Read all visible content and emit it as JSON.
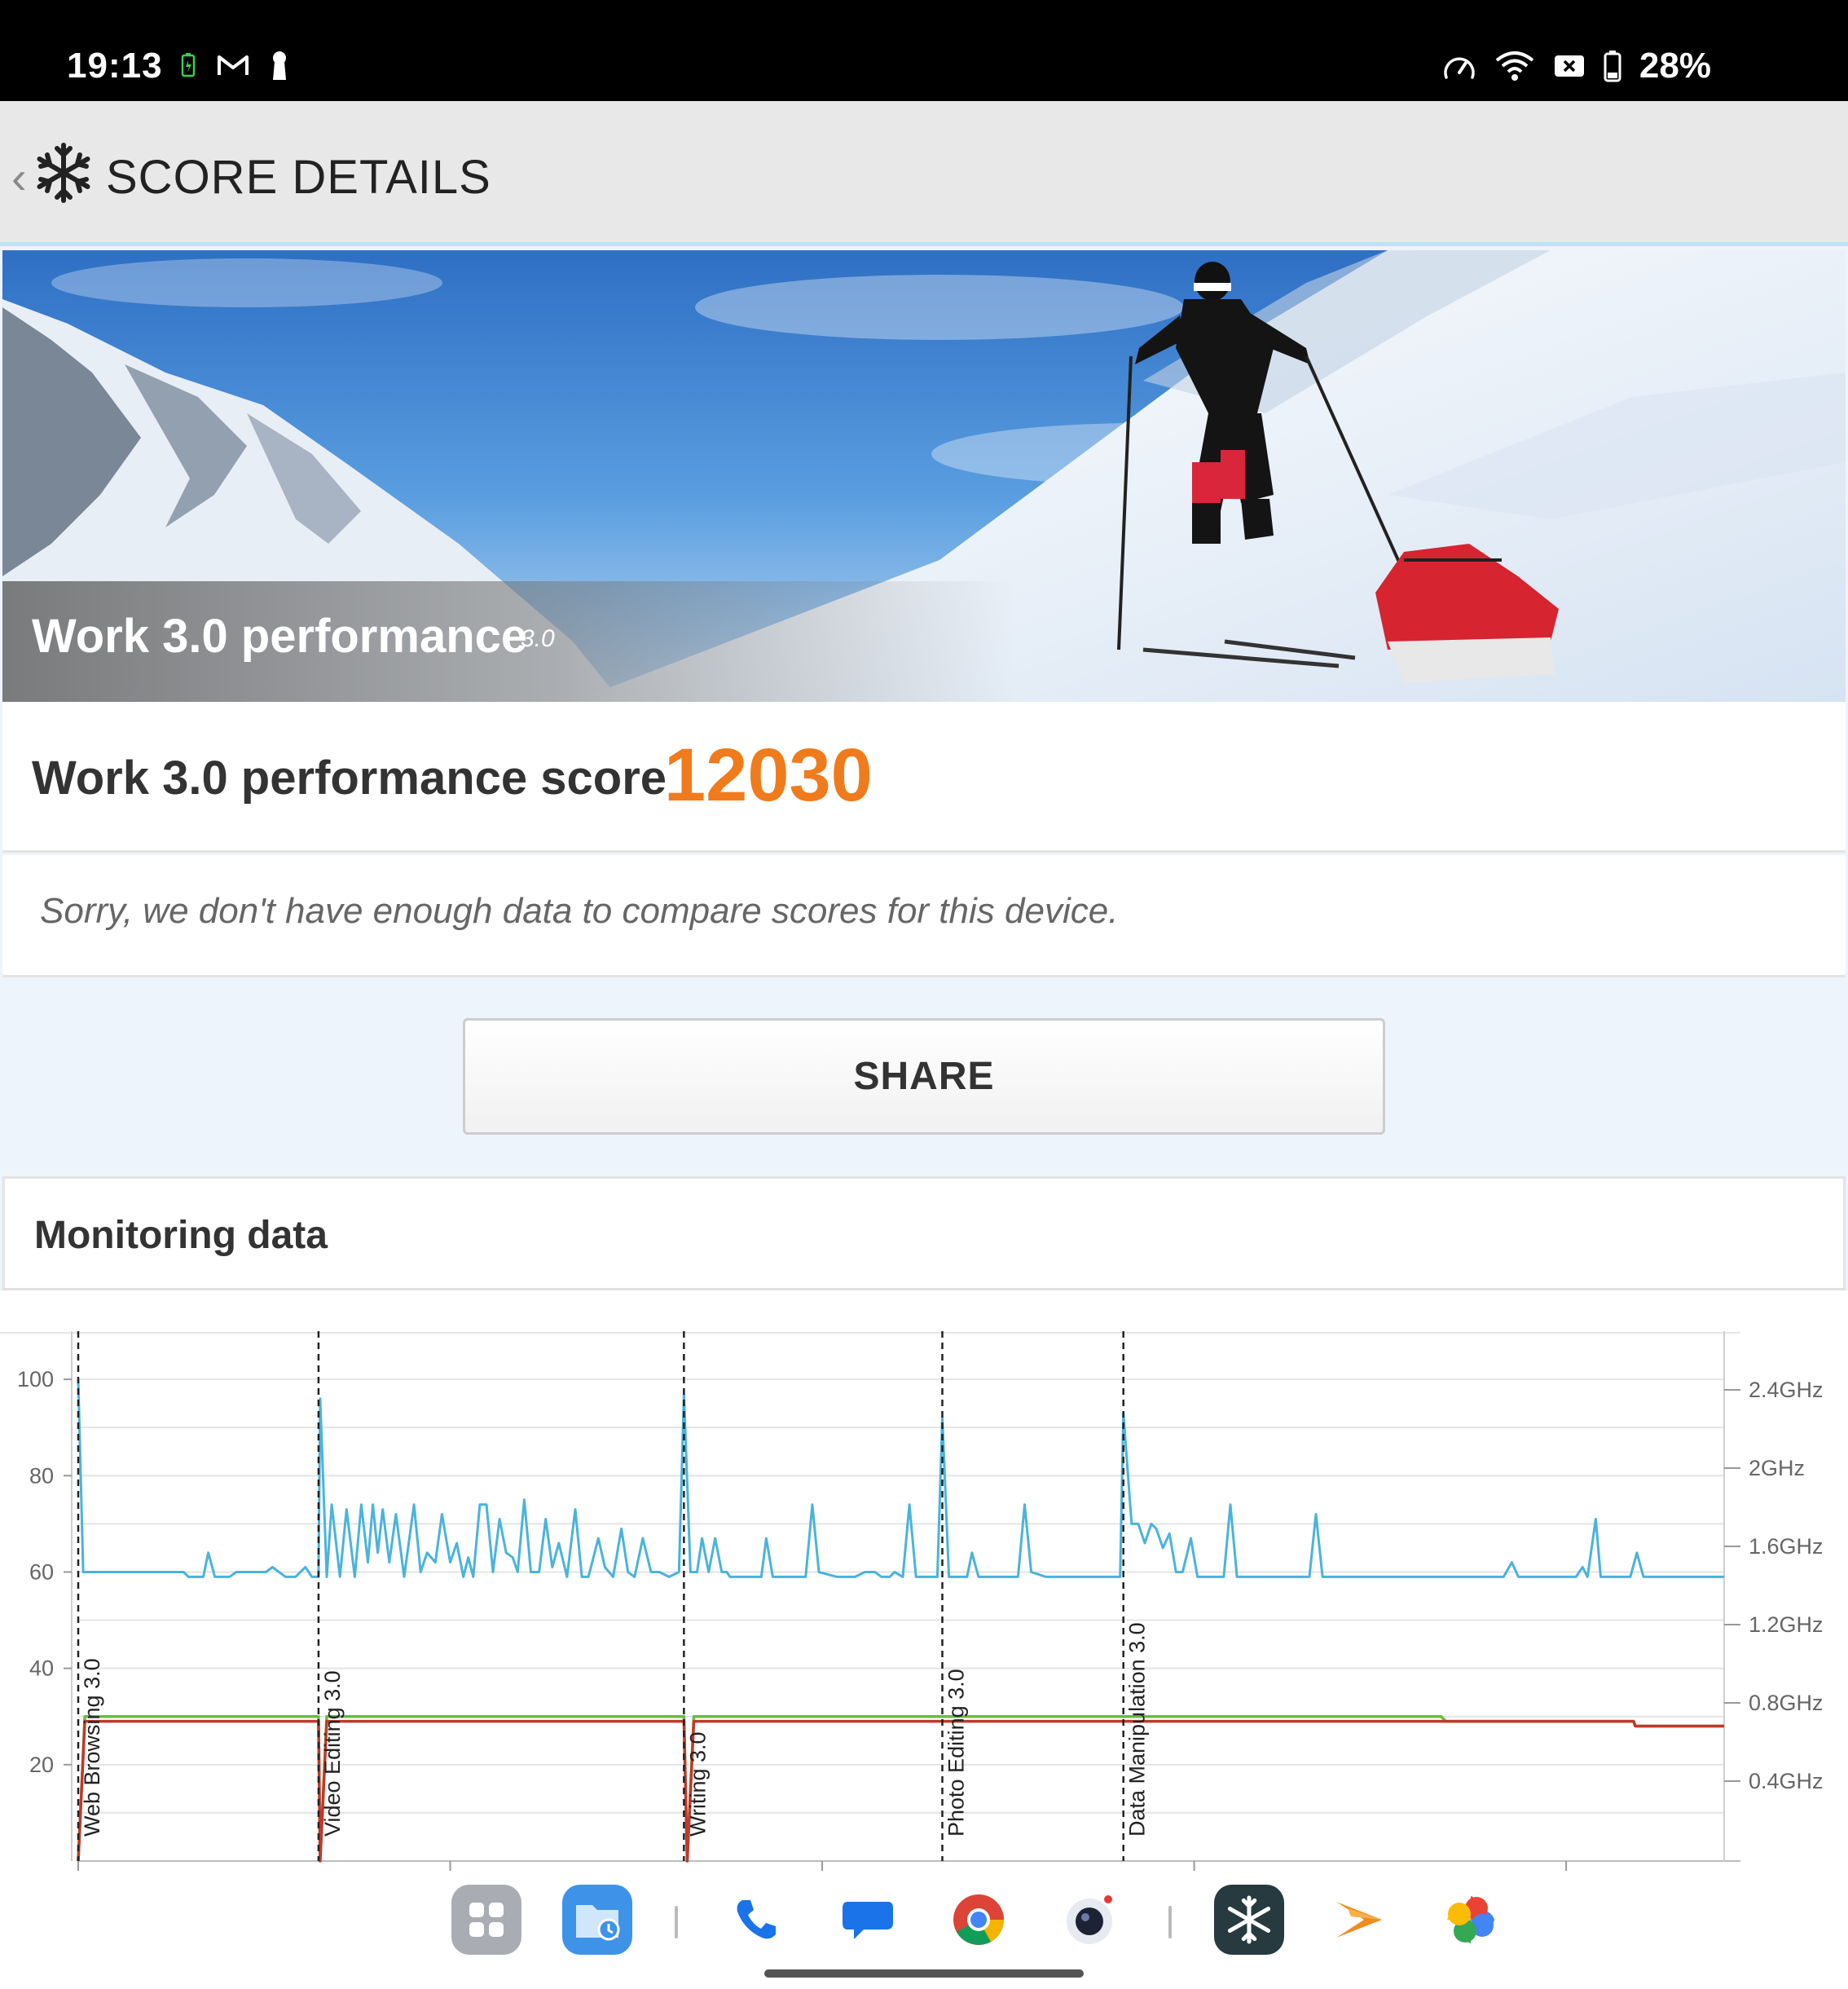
{
  "status_bar": {
    "time": "19:13",
    "battery": "28%",
    "left_icons": [
      "battery-saver-icon",
      "gmail-icon",
      "keyhole-icon"
    ],
    "right_icons": [
      "speedometer-icon",
      "wifi-icon",
      "no-sim-icon",
      "battery-icon"
    ]
  },
  "header": {
    "title": "SCORE DETAILS",
    "logo": "3dmark-snowflake-icon",
    "back": "back-chevron-icon"
  },
  "hero": {
    "title": "Work 3.0 performance",
    "version": "3.0"
  },
  "score": {
    "label": "Work 3.0 performance score",
    "value": "12030",
    "value_color": "#f07b1c"
  },
  "compare": {
    "message": "Sorry, we don't have enough data to compare scores for this device."
  },
  "share": {
    "label": "SHARE"
  },
  "monitoring": {
    "title": "Monitoring data"
  },
  "chart_data": {
    "type": "line",
    "left_axis": {
      "ticks": [
        "100",
        "80",
        "60",
        "40",
        "20"
      ],
      "range": [
        0,
        110
      ]
    },
    "right_axis": {
      "ticks": [
        "2.4GHz",
        "2GHz",
        "1.6GHz",
        "1.2GHz",
        "0.8GHz",
        "0.4GHz"
      ]
    },
    "phases": [
      {
        "label": "Web Browsing 3.0",
        "start": 0
      },
      {
        "label": "Video Editing 3.0",
        "start": 14.6
      },
      {
        "label": "Writing 3.0",
        "start": 36.8
      },
      {
        "label": "Photo Editing 3.0",
        "start": 52.5
      },
      {
        "label": "Data Manipulation 3.0",
        "start": 63.5
      }
    ],
    "x_range": [
      0,
      100
    ],
    "colors": {
      "frequency": "#4ab3dc",
      "battery": "#6bbf3a",
      "temperature": "#c0392b"
    },
    "series": [
      {
        "values": [
          [
            0,
            100
          ],
          [
            0.3,
            60
          ],
          [
            3,
            60
          ],
          [
            3.2,
            60
          ],
          [
            3.5,
            60
          ],
          [
            3.9,
            60
          ],
          [
            4.4,
            60
          ],
          [
            5.2,
            60
          ],
          [
            6,
            60
          ],
          [
            6.4,
            60
          ],
          [
            6.7,
            59
          ],
          [
            7.6,
            59
          ],
          [
            7.9,
            64
          ],
          [
            8.3,
            59
          ],
          [
            9.2,
            59
          ],
          [
            9.6,
            60
          ],
          [
            10,
            60
          ],
          [
            10.3,
            60
          ],
          [
            10.7,
            60
          ],
          [
            11,
            60
          ],
          [
            11.4,
            60
          ],
          [
            11.8,
            61
          ],
          [
            12.2,
            60
          ],
          [
            12.6,
            59
          ],
          [
            13.2,
            59
          ],
          [
            13.8,
            61
          ],
          [
            14.2,
            59
          ],
          [
            14.6,
            59
          ],
          [
            14.7,
            96
          ],
          [
            15.1,
            59
          ],
          [
            15.4,
            74
          ],
          [
            15.9,
            59
          ],
          [
            16.3,
            73
          ],
          [
            16.8,
            59
          ],
          [
            17.2,
            74
          ],
          [
            17.6,
            62
          ],
          [
            17.9,
            74
          ],
          [
            18.2,
            64
          ],
          [
            18.5,
            73
          ],
          [
            18.9,
            62
          ],
          [
            19.3,
            72
          ],
          [
            19.8,
            59
          ],
          [
            20.4,
            74
          ],
          [
            20.8,
            60
          ],
          [
            21.2,
            64
          ],
          [
            21.7,
            62
          ],
          [
            22.1,
            72
          ],
          [
            22.6,
            62
          ],
          [
            23,
            66
          ],
          [
            23.4,
            59
          ],
          [
            23.7,
            63
          ],
          [
            24,
            59
          ],
          [
            24.4,
            74
          ],
          [
            24.8,
            74
          ],
          [
            25.2,
            60
          ],
          [
            25.6,
            71
          ],
          [
            26,
            64
          ],
          [
            26.4,
            63
          ],
          [
            26.7,
            60
          ],
          [
            27.1,
            75
          ],
          [
            27.5,
            60
          ],
          [
            28,
            60
          ],
          [
            28.4,
            71
          ],
          [
            28.8,
            61
          ],
          [
            29.2,
            66
          ],
          [
            29.7,
            59
          ],
          [
            30.2,
            73
          ],
          [
            30.6,
            59
          ],
          [
            31,
            59
          ],
          [
            31.6,
            67
          ],
          [
            32,
            61
          ],
          [
            32.5,
            59
          ],
          [
            33,
            69
          ],
          [
            33.4,
            60
          ],
          [
            33.8,
            59
          ],
          [
            34.3,
            67
          ],
          [
            34.8,
            60
          ],
          [
            35.3,
            60
          ],
          [
            35.9,
            59
          ],
          [
            36.5,
            60
          ],
          [
            36.8,
            97
          ],
          [
            37.2,
            60
          ],
          [
            37.6,
            60
          ],
          [
            37.9,
            67
          ],
          [
            38.3,
            60
          ],
          [
            38.7,
            67
          ],
          [
            39.1,
            60
          ],
          [
            39.4,
            60
          ],
          [
            39.6,
            59
          ],
          [
            40.3,
            59
          ],
          [
            41.5,
            59
          ],
          [
            41.8,
            67
          ],
          [
            42.2,
            59
          ],
          [
            43.3,
            59
          ],
          [
            44.2,
            59
          ],
          [
            44.6,
            74
          ],
          [
            45,
            60
          ],
          [
            46.1,
            59
          ],
          [
            47.2,
            59
          ],
          [
            47.8,
            60
          ],
          [
            48.4,
            60
          ],
          [
            48.8,
            59
          ],
          [
            49.3,
            59
          ],
          [
            49.6,
            60
          ],
          [
            50.1,
            59
          ],
          [
            50.5,
            74
          ],
          [
            50.9,
            59
          ],
          [
            51.6,
            59
          ],
          [
            52.2,
            59
          ],
          [
            52.5,
            92
          ],
          [
            52.9,
            59
          ],
          [
            54,
            59
          ],
          [
            54.3,
            64
          ],
          [
            54.7,
            59
          ],
          [
            57.1,
            59
          ],
          [
            57.5,
            74
          ],
          [
            57.9,
            60
          ],
          [
            58.8,
            59
          ],
          [
            60.3,
            59
          ],
          [
            61.4,
            59
          ],
          [
            62.4,
            59
          ],
          [
            63.3,
            59
          ],
          [
            63.5,
            93
          ],
          [
            64,
            70
          ],
          [
            64.4,
            70
          ],
          [
            64.8,
            66
          ],
          [
            65.2,
            70
          ],
          [
            65.5,
            69
          ],
          [
            65.9,
            65
          ],
          [
            66.3,
            68
          ],
          [
            66.7,
            60
          ],
          [
            67.1,
            60
          ],
          [
            67.6,
            67
          ],
          [
            68,
            59
          ],
          [
            69.6,
            59
          ],
          [
            70,
            74
          ],
          [
            70.4,
            59
          ],
          [
            70.8,
            59
          ],
          [
            71.2,
            59
          ],
          [
            72,
            59
          ],
          [
            72.9,
            59
          ],
          [
            74.8,
            59
          ],
          [
            75.2,
            72
          ],
          [
            75.6,
            59
          ],
          [
            78.8,
            59
          ],
          [
            81,
            59
          ],
          [
            85.6,
            59
          ],
          [
            86.6,
            59
          ],
          [
            87.1,
            62
          ],
          [
            87.5,
            59
          ],
          [
            89,
            59
          ],
          [
            90.2,
            59
          ],
          [
            91,
            59
          ],
          [
            91.4,
            61
          ],
          [
            91.7,
            59
          ],
          [
            92.2,
            71
          ],
          [
            92.5,
            59
          ],
          [
            94.3,
            59
          ],
          [
            94.7,
            64
          ],
          [
            95.1,
            59
          ],
          [
            96.8,
            59
          ],
          [
            98.8,
            59
          ],
          [
            100,
            59
          ]
        ]
      },
      {
        "values": [
          [
            0,
            0
          ],
          [
            0.4,
            30
          ],
          [
            14.6,
            30
          ],
          [
            14.7,
            0
          ],
          [
            15.1,
            30
          ],
          [
            36.8,
            30
          ],
          [
            37,
            0
          ],
          [
            37.4,
            30
          ],
          [
            82.8,
            30
          ],
          [
            83.1,
            29
          ],
          [
            94.5,
            29
          ],
          [
            94.6,
            28
          ],
          [
            100,
            28
          ]
        ]
      },
      {
        "values": [
          [
            0,
            0
          ],
          [
            0.4,
            29
          ],
          [
            14.6,
            29
          ],
          [
            14.7,
            0
          ],
          [
            15.1,
            29
          ],
          [
            36.8,
            29
          ],
          [
            37,
            0
          ],
          [
            37.4,
            29
          ],
          [
            82.8,
            29
          ],
          [
            94.5,
            29
          ],
          [
            94.6,
            28
          ],
          [
            100,
            28
          ]
        ]
      }
    ]
  },
  "dock": {
    "apps": [
      "app-drawer-icon",
      "files-icon",
      "phone-icon",
      "messages-icon",
      "chrome-icon",
      "camera-icon",
      "3dmark-icon",
      "streaks-icon",
      "photos-icon"
    ]
  }
}
